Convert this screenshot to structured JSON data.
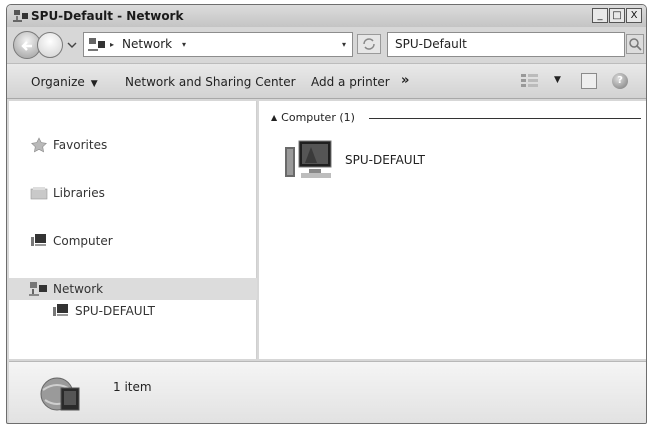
{
  "window": {
    "title": "SPU-Default - Network",
    "minimize": "_",
    "maximize": "□",
    "close": "X"
  },
  "address": {
    "crumb": "Network",
    "search_value": "SPU-Default"
  },
  "toolbar": {
    "organize": "Organize",
    "network_sharing": "Network and Sharing Center",
    "add_printer": "Add a printer",
    "more": "»"
  },
  "navpane": {
    "items": [
      {
        "label": "Favorites",
        "icon": "star-icon"
      },
      {
        "label": "Libraries",
        "icon": "library-icon"
      },
      {
        "label": "Computer",
        "icon": "computer-icon"
      },
      {
        "label": "Network",
        "icon": "network-icon",
        "selected": true
      },
      {
        "label": "SPU-DEFAULT",
        "icon": "computer-icon",
        "child": true
      }
    ]
  },
  "content": {
    "group_label": "Computer (1)",
    "items": [
      {
        "label": "SPU-DEFAULT",
        "icon": "computer-icon"
      }
    ]
  },
  "details": {
    "text": "1 item"
  },
  "colors": {
    "window_bg": "#d7d7d7",
    "pane_bg": "#ffffff",
    "selected_bg": "#dcdcdc"
  }
}
